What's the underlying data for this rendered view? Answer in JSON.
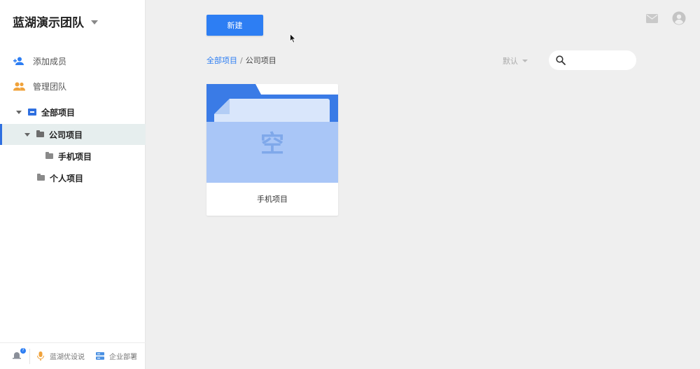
{
  "sidebar": {
    "team_name": "蓝湖演示团队",
    "menu": [
      {
        "label": "添加成员",
        "icon": "add-user-icon"
      },
      {
        "label": "管理团队",
        "icon": "team-icon"
      }
    ],
    "tree": {
      "root": "全部项目",
      "company": "公司项目",
      "mobile": "手机项目",
      "personal": "个人项目"
    },
    "footer": {
      "link1": "蓝湖优设说",
      "link2": "企业部署",
      "notify_badge": "?"
    }
  },
  "toolbar": {
    "new_label": "新建",
    "sort_label": "默认"
  },
  "breadcrumb": {
    "root": "全部项目",
    "separator": "/",
    "current": "公司项目"
  },
  "search": {
    "placeholder": ""
  },
  "projects": [
    {
      "name": "手机项目",
      "empty_label": "空"
    }
  ],
  "colors": {
    "accent": "#2d7ef3",
    "folder_dark": "#3a7be6",
    "folder_light": "#a9c6f7",
    "background": "#efefef"
  }
}
